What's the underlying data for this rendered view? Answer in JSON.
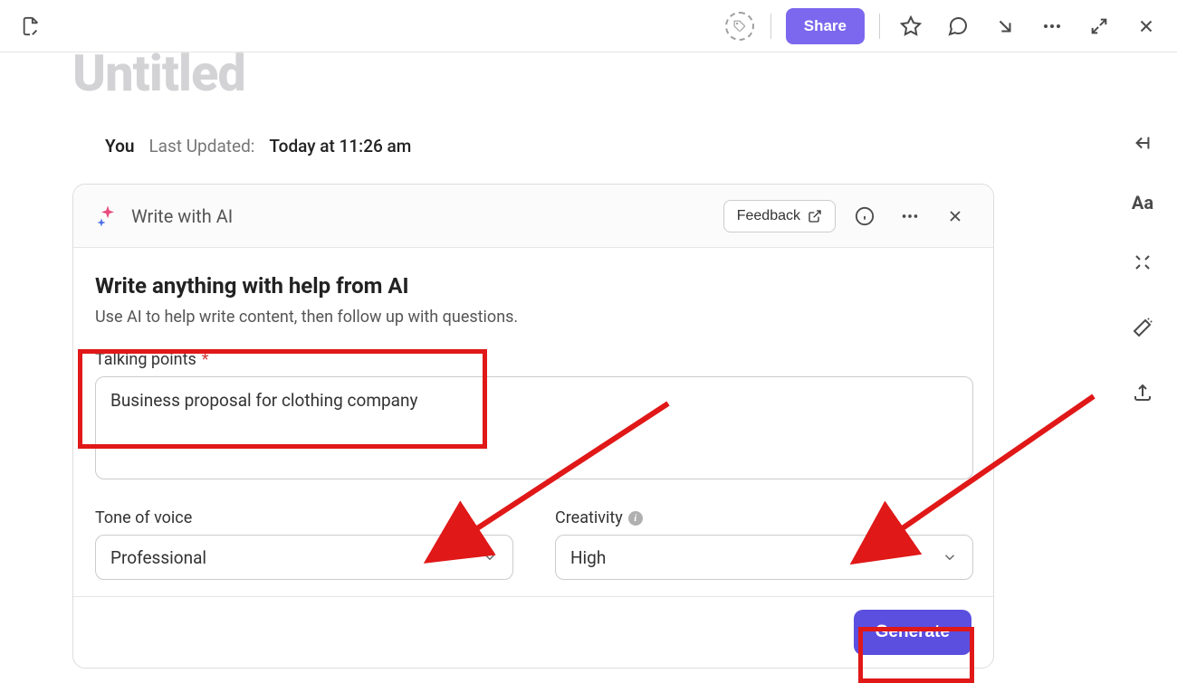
{
  "toolbar": {
    "share_label": "Share"
  },
  "document": {
    "title": "Untitled",
    "author": "You",
    "updated_label": "Last Updated:",
    "updated_value": "Today at 11:26 am"
  },
  "ai_panel": {
    "icon_name": "sparkle-icon",
    "title": "Write with AI",
    "feedback_label": "Feedback",
    "heading": "Write anything with help from AI",
    "subheading": "Use AI to help write content, then follow up with questions.",
    "fields": {
      "talking_points": {
        "label": "Talking points",
        "required": true,
        "value": "Business proposal for clothing company"
      },
      "tone": {
        "label": "Tone of voice",
        "value": "Professional"
      },
      "creativity": {
        "label": "Creativity",
        "value": "High"
      }
    },
    "generate_label": "Generate"
  },
  "colors": {
    "share_bg": "#7b68ee",
    "generate_bg": "#5b4fe0",
    "annotation": "#e01818"
  }
}
